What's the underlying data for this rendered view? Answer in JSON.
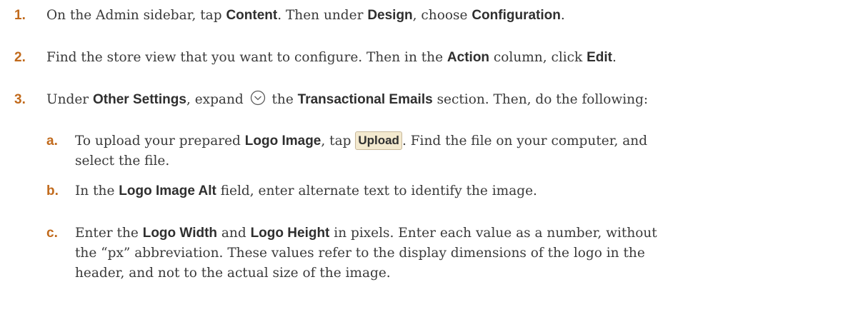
{
  "steps": [
    {
      "num": "1.",
      "p1": "On the Admin sidebar, tap ",
      "b1": "Content",
      "p2": ". Then under ",
      "b2": "Design",
      "p3": ", choose ",
      "b3": "Configuration",
      "p4": "."
    },
    {
      "num": "2.",
      "p1": "Find the store view that you want to configure. Then in the ",
      "b1": "Action",
      "p2": " column, click ",
      "b2": "Edit",
      "p3": "."
    },
    {
      "num": "3.",
      "p1": "Under ",
      "b1": "Other Settings",
      "p2": ", expand ",
      "icon": "chevron-circle-down-icon",
      "p3": " the ",
      "b2": "Transactional Emails",
      "p4": " section. Then, do the following:"
    }
  ],
  "substeps": [
    {
      "num": "a.",
      "p1": "To upload your prepared ",
      "b1": "Logo Image",
      "p2": ", tap ",
      "button": "Upload",
      "p3": ". Find the file on your computer, and",
      "line2": "select the file."
    },
    {
      "num": "b.",
      "p1": "In the ",
      "b1": "Logo Image Alt",
      "p2": " field, enter alternate text to identify the image."
    },
    {
      "num": "c.",
      "p1": "Enter the ",
      "b1": "Logo Width",
      "p2": " and ",
      "b2": "Logo Height",
      "p3": " in pixels. Enter each value as a number, without",
      "line2": "the “px” abbreviation. These values refer to the display dimensions of the logo in the",
      "line3": "header, and not to the actual size of the image."
    }
  ],
  "colors": {
    "step_number": "#c16a1c",
    "button_bg": "#f3e9cf"
  }
}
